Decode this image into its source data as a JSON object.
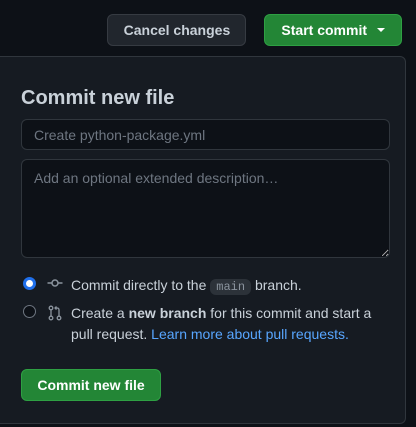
{
  "header": {
    "cancel_label": "Cancel changes",
    "start_commit_label": "Start commit"
  },
  "commit_panel": {
    "title": "Commit new file",
    "summary_placeholder": "Create python-package.yml",
    "description_placeholder": "Add an optional extended description…",
    "option_direct": {
      "prefix": "Commit directly to the ",
      "branch": "main",
      "suffix": " branch.",
      "checked": true,
      "icon": "git-commit-icon"
    },
    "option_new_branch": {
      "prefix": "Create a ",
      "bold": "new branch",
      "middle": " for this commit and start a pull request. ",
      "link": "Learn more about pull requests.",
      "checked": false,
      "icon": "git-pull-request-icon"
    },
    "submit_label": "Commit new file"
  },
  "colors": {
    "primary": "#238636",
    "link": "#58a6ff",
    "radio_accent": "#1f6feb"
  }
}
